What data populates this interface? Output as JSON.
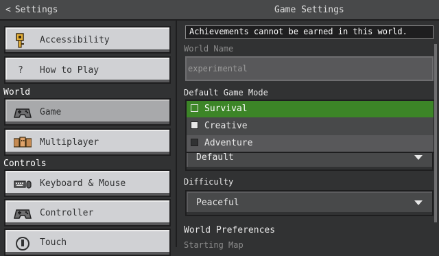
{
  "header": {
    "back_label": "Settings",
    "title": "Game Settings"
  },
  "sidebar": {
    "items": [
      {
        "label": "Accessibility",
        "icon": "key-icon"
      },
      {
        "label": "How to Play",
        "icon": "question-icon"
      },
      {
        "label": "Game",
        "icon": "gamepad-icon"
      },
      {
        "label": "Multiplayer",
        "icon": "multiplayer-icon"
      },
      {
        "label": "Keyboard & Mouse",
        "icon": "keyboard-mouse-icon"
      },
      {
        "label": "Controller",
        "icon": "controller-icon"
      },
      {
        "label": "Touch",
        "icon": "touch-icon"
      }
    ],
    "sections": {
      "world": "World",
      "controls": "Controls"
    },
    "question_glyph": "?"
  },
  "main": {
    "banner": "Achievements cannot be earned in this world.",
    "world_name_label": "World Name",
    "world_name_value": "experimental",
    "game_mode_label": "Default Game Mode",
    "game_mode_options": [
      "Survival",
      "Creative",
      "Adventure"
    ],
    "game_mode_value": "Default",
    "difficulty_label": "Difficulty",
    "difficulty_value": "Peaceful",
    "world_prefs_label": "World Preferences",
    "starting_map_label": "Starting Map"
  },
  "colors": {
    "selected_option": "#3c8527",
    "button_face": "#d0d1d4",
    "background": "#313233"
  }
}
